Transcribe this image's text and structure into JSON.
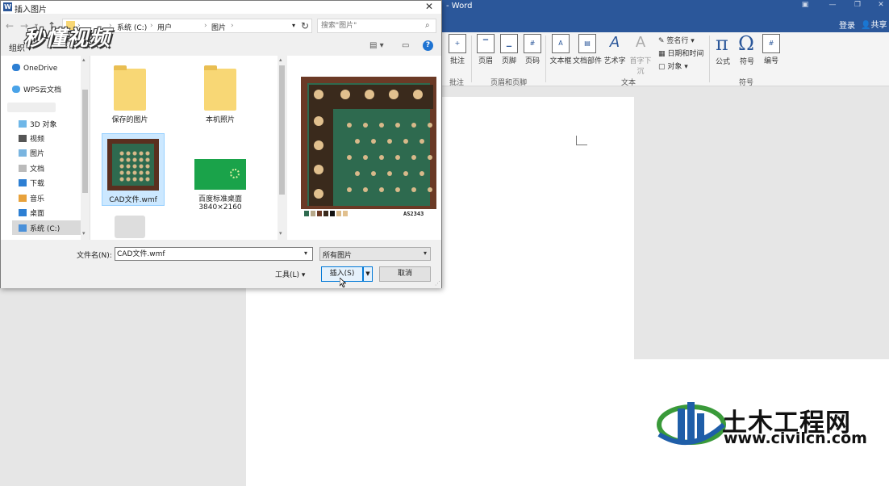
{
  "word": {
    "title": "- Word",
    "signin": "登录",
    "share": "共享",
    "ribbon": {
      "comment": "批注",
      "header": "页眉",
      "footer": "页脚",
      "page_number": "页码",
      "textbox": "文本框",
      "quick_parts": "文档部件",
      "wordart": "艺术字",
      "dropcap": "首字下沉",
      "signature_line": "签名行",
      "date_time": "日期和时间",
      "object": "对象",
      "equation": "公式",
      "symbol": "符号",
      "number": "编号",
      "group_comment": "批注",
      "group_header_footer": "页眉和页脚",
      "group_text": "文本",
      "group_symbols": "符号"
    }
  },
  "dialog": {
    "title": "插入图片",
    "breadcrumb": [
      "系统 (C:)",
      "用户",
      "图片"
    ],
    "search_placeholder": "搜索\"图片\"",
    "organize": "组织",
    "watermark_logo": "秒懂视频",
    "nav_items": [
      "OneDrive",
      "WPS云文档",
      "3D 对象",
      "视频",
      "图片",
      "文档",
      "下载",
      "音乐",
      "桌面",
      "系统 (C:)"
    ],
    "files": [
      {
        "name": "保存的图片"
      },
      {
        "name": "本机照片"
      },
      {
        "name": "CAD文件.wmf"
      },
      {
        "name": "百度标准桌面",
        "sub": "3840×2160"
      }
    ],
    "preview_caption": "AS2343",
    "filename_label": "文件名(N):",
    "filename_value": "CAD文件.wmf",
    "filetype": "所有图片",
    "tools": "工具(L)",
    "insert": "插入(S)",
    "cancel": "取消"
  },
  "watermark": {
    "name": "土木工程网",
    "url": "www.civilcn.com"
  }
}
